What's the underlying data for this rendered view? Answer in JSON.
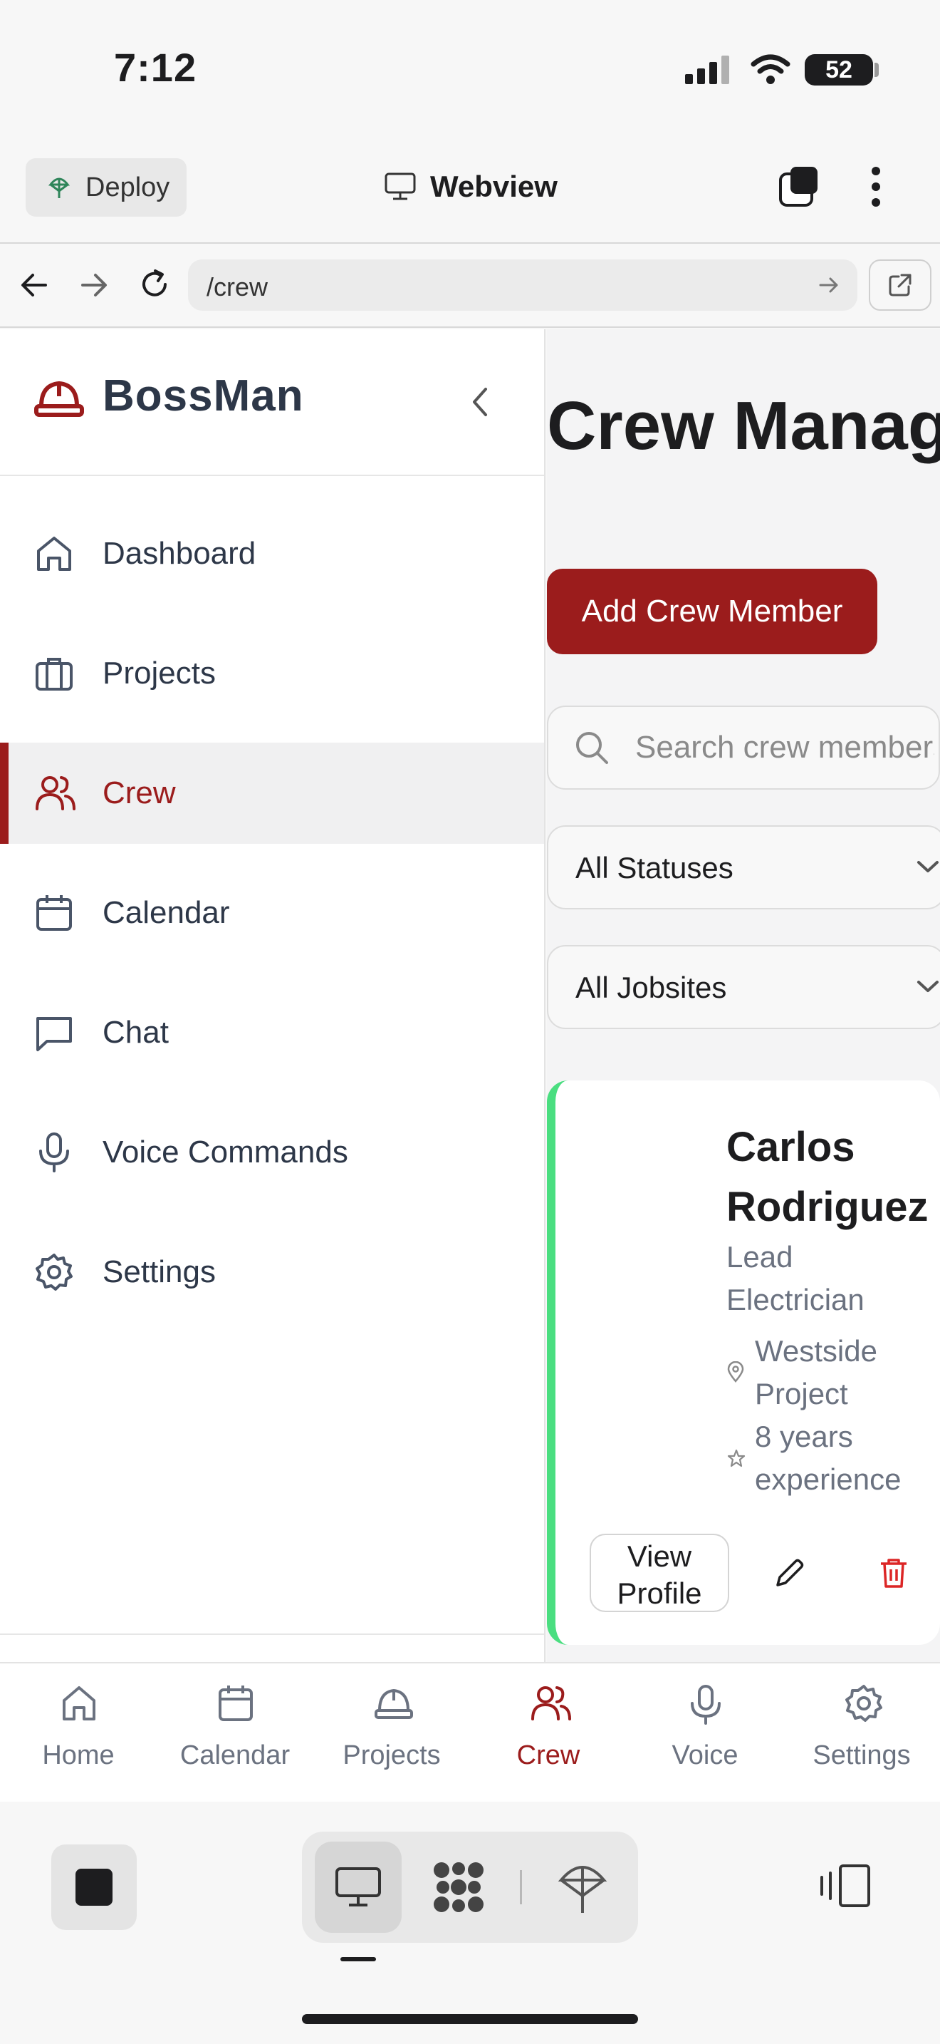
{
  "status_bar": {
    "time": "7:12",
    "battery": "52"
  },
  "toolbar": {
    "deploy_label": "Deploy",
    "webview_label": "Webview"
  },
  "browser": {
    "url": "/crew"
  },
  "sidebar": {
    "brand": "BossMan",
    "items": [
      {
        "label": "Dashboard",
        "icon": "home-icon",
        "active": false
      },
      {
        "label": "Projects",
        "icon": "briefcase-icon",
        "active": false
      },
      {
        "label": "Crew",
        "icon": "users-icon",
        "active": true
      },
      {
        "label": "Calendar",
        "icon": "calendar-icon",
        "active": false
      },
      {
        "label": "Chat",
        "icon": "chat-icon",
        "active": false
      },
      {
        "label": "Voice Commands",
        "icon": "mic-icon",
        "active": false
      },
      {
        "label": "Settings",
        "icon": "gear-icon",
        "active": false
      }
    ]
  },
  "main": {
    "title": "Crew Management",
    "add_button": "Add Crew Member",
    "search_placeholder": "Search crew members...",
    "status_filter": "All Statuses",
    "jobsite_filter": "All Jobsites",
    "crew": [
      {
        "name": "Carlos Rodriguez",
        "role": "Lead Electrician",
        "site": "Westside Project",
        "experience": "8 years experience",
        "status_color": "#4ade80",
        "view_label": "View Profile"
      }
    ]
  },
  "bottom_nav": [
    {
      "label": "Home",
      "icon": "home-icon",
      "active": false
    },
    {
      "label": "Calendar",
      "icon": "calendar-icon",
      "active": false
    },
    {
      "label": "Projects",
      "icon": "hardhat-icon",
      "active": false
    },
    {
      "label": "Crew",
      "icon": "users-icon",
      "active": true
    },
    {
      "label": "Voice",
      "icon": "mic-icon",
      "active": false
    },
    {
      "label": "Settings",
      "icon": "gear-icon",
      "active": false
    }
  ],
  "colors": {
    "accent": "#9b1c1c",
    "status_active": "#4ade80",
    "text_muted": "#6b7280"
  }
}
